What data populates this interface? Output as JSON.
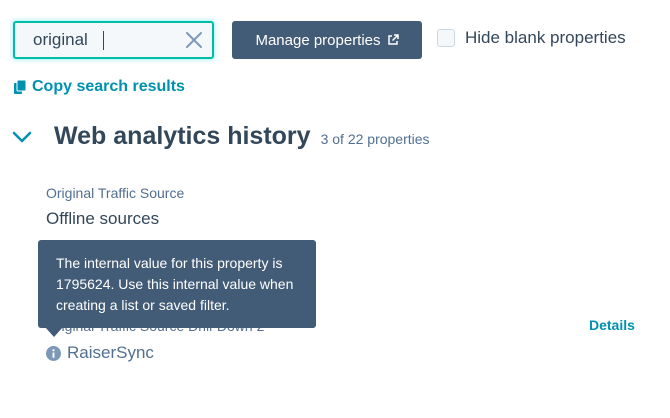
{
  "search": {
    "value": "original",
    "placeholder": ""
  },
  "toolbar": {
    "manage_label": "Manage properties",
    "hide_blank_label": "Hide blank properties",
    "hide_blank_checked": false
  },
  "copy_link": {
    "label": "Copy search results"
  },
  "section": {
    "title": "Web analytics history",
    "count": "3 of 22 properties"
  },
  "properties": [
    {
      "label": "Original Traffic Source",
      "value": "Offline sources"
    },
    {
      "label": "Original Traffic Source Drill-Down 2",
      "value": "RaiserSync"
    }
  ],
  "details_label": "Details",
  "tooltip": {
    "text": "The internal value for this property is 1795624. Use this internal value when creating a list or saved filter."
  },
  "colors": {
    "accent": "#0091ae",
    "button_bg": "#425b76",
    "text": "#33475b",
    "focus_border": "#00bda5"
  },
  "icons": {
    "clear": "close-icon",
    "external": "external-link-icon",
    "copy": "copy-icon",
    "chevron": "chevron-down-icon",
    "info": "info-icon"
  }
}
